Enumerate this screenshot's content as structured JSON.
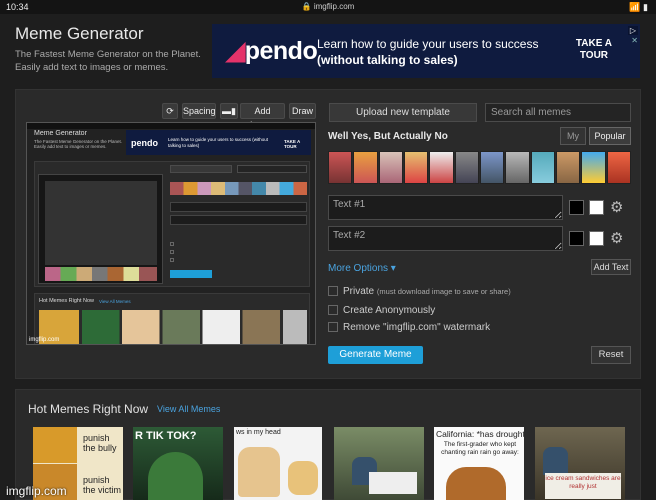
{
  "statusbar": {
    "time": "10:34",
    "url": "🔒 imgflip.com",
    "icons": "📶 ▮"
  },
  "header": {
    "title": "Meme Generator",
    "subtitle": "The Fastest Meme Generator on the Planet. Easily add text to images or memes."
  },
  "ad": {
    "logo": "pendo",
    "line1": "Learn how to guide your users to success",
    "line2": "(without talking to sales)",
    "cta_line1": "TAKE A",
    "cta_line2": "TOUR"
  },
  "toolbar": {
    "rotate_icon": "⟳",
    "spacing_label": "Spacing",
    "add_image_icon": "▬▮",
    "add_image_label": "Add Image",
    "draw_label": "Draw"
  },
  "editor": {
    "upload_label": "Upload new template",
    "search_placeholder": "Search all memes",
    "template_name": "Well Yes, But Actually No",
    "tab_my": "My",
    "tab_popular": "Popular",
    "text1_placeholder": "Text #1",
    "text2_placeholder": "Text #2",
    "more_options": "More Options ▾",
    "add_text": "Add Text",
    "private_label": "Private",
    "private_note": "(must download image to save or share)",
    "anon_label": "Create Anonymously",
    "watermark_label": "Remove \"imgflip.com\" watermark",
    "generate_label": "Generate Meme",
    "reset_label": "Reset"
  },
  "hot": {
    "title": "Hot Memes Right Now",
    "view_all": "View All Memes",
    "meme1_top": "punish the bully",
    "meme1_bottom": "punish the victim",
    "meme2_text": "R TIK TOK?",
    "meme3_text": "ws in my head",
    "meme6_text": "California: *has drought*",
    "meme6_sub": "The first-grader who kept chanting rain rain go away:",
    "meme7_text": "ice cream sandwiches are really just"
  },
  "inset": {
    "title": "Meme Generator",
    "subtitle": "The Fastest Meme Generator on the Planet. Easily add text to images or memes.",
    "ad_line": "Learn how to guide your users to success (without talking to sales)",
    "ad_cta": "TAKE A TOUR",
    "hot_title": "Hot Memes Right Now",
    "hot_link": "View All Memes",
    "watermark": "imgflip.com"
  },
  "watermark": "imgflip.com",
  "colors": {
    "accent": "#1e9fd8",
    "link": "#4aa3df",
    "panel": "#2a2a2a",
    "background": "#1e1e1e",
    "ad_bg": "#0f1b3f",
    "pendo_mark": "#e5336a"
  }
}
